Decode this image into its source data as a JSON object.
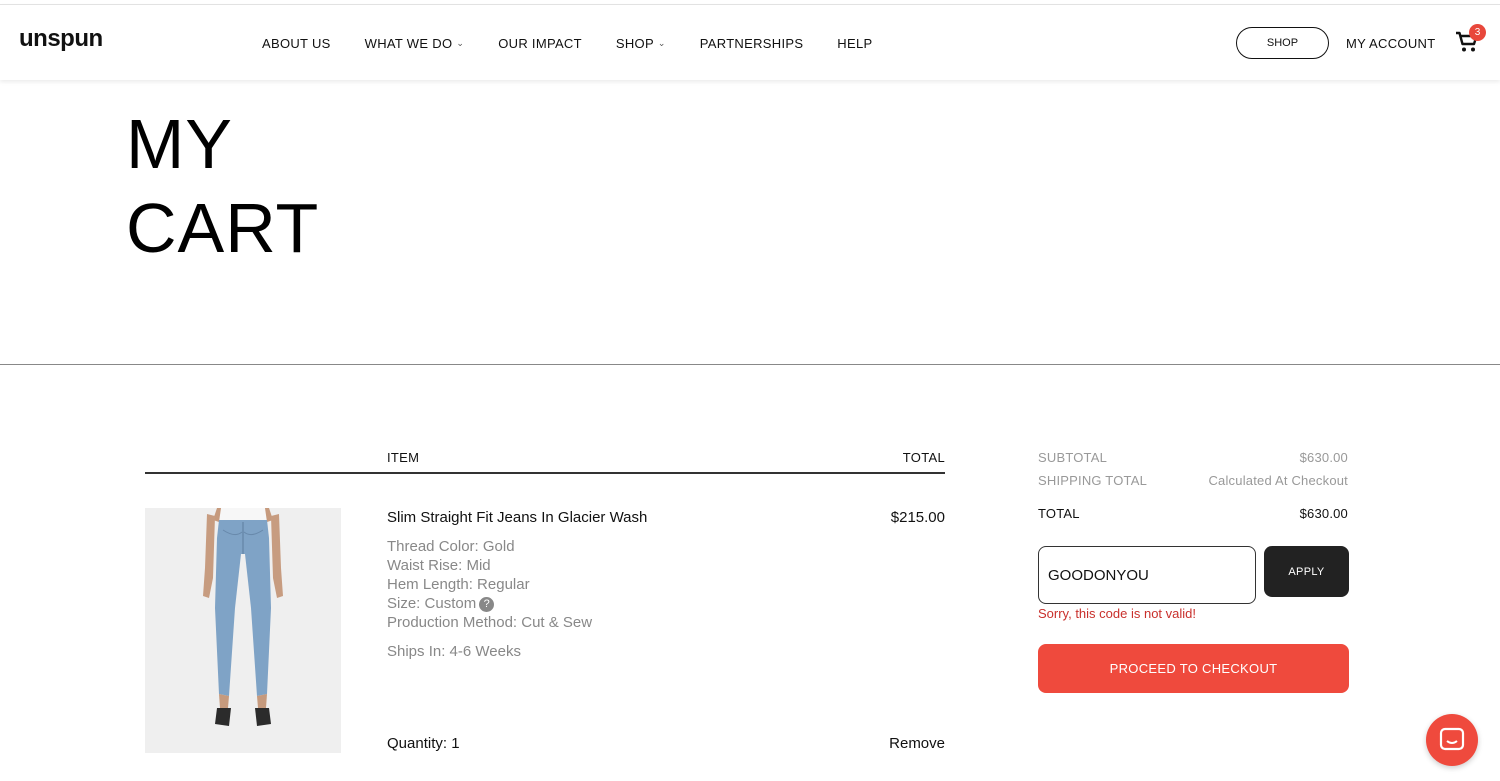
{
  "header": {
    "logo": "unspun",
    "nav": [
      {
        "label": "ABOUT US",
        "dropdown": false
      },
      {
        "label": "WHAT WE DO",
        "dropdown": true
      },
      {
        "label": "OUR IMPACT",
        "dropdown": false
      },
      {
        "label": "SHOP",
        "dropdown": true
      },
      {
        "label": "PARTNERSHIPS",
        "dropdown": false
      },
      {
        "label": "HELP",
        "dropdown": false
      }
    ],
    "shop_button": "SHOP",
    "account": "MY ACCOUNT",
    "cart_count": "3"
  },
  "page": {
    "title_line1": "MY",
    "title_line2": "CART"
  },
  "table": {
    "item_header": "ITEM",
    "total_header": "TOTAL"
  },
  "product": {
    "name": "Slim Straight Fit Jeans In Glacier Wash",
    "price": "$215.00",
    "thread_color": "Thread Color: Gold",
    "waist_rise": "Waist Rise: Mid",
    "hem_length": "Hem Length: Regular",
    "size": "Size: Custom",
    "production_method": "Production Method: Cut & Sew",
    "ships_in": "Ships In: 4-6 Weeks",
    "quantity": "Quantity: 1",
    "remove": "Remove"
  },
  "summary": {
    "subtotal_label": "SUBTOTAL",
    "subtotal_value": "$630.00",
    "shipping_label": "SHIPPING TOTAL",
    "shipping_value": "Calculated At Checkout",
    "total_label": "TOTAL",
    "total_value": "$630.00",
    "coupon_value": "GOODONYOU",
    "apply": "APPLY",
    "error": "Sorry, this code is not valid!",
    "checkout": "PROCEED TO CHECKOUT"
  },
  "colors": {
    "accent": "#ef4a3d",
    "error": "#c9302c",
    "dark_button": "#222222",
    "muted_text": "#888888"
  },
  "icons": {
    "cart": "cart-icon",
    "help": "question-icon",
    "chat": "chat-icon",
    "chevron": "chevron-down-icon"
  }
}
